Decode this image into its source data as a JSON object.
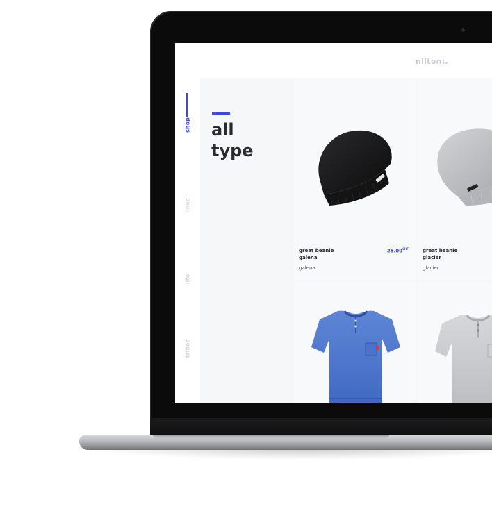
{
  "brand": "nilton:.",
  "nav": {
    "items": [
      {
        "label": "shop",
        "active": true
      },
      {
        "label": "lines",
        "active": false
      },
      {
        "label": "life",
        "active": false
      },
      {
        "label": "tribes",
        "active": false
      }
    ]
  },
  "heading": {
    "line1": "all",
    "line2": "type"
  },
  "products": [
    {
      "name_line1": "great beanie",
      "name_line2": "galena",
      "variant": "galena",
      "price": "25.00",
      "currency": "CHF",
      "image": "black-beanie"
    },
    {
      "name_line1": "great beanie",
      "name_line2": "glacier",
      "variant": "glacier",
      "image": "grey-beanie"
    },
    {
      "image": "blue-henley-tshirt"
    },
    {
      "image": "grey-henley-tshirt"
    }
  ],
  "colors": {
    "accent": "#3b49e0",
    "text": "#2a2b30",
    "muted": "#d6d8de"
  }
}
